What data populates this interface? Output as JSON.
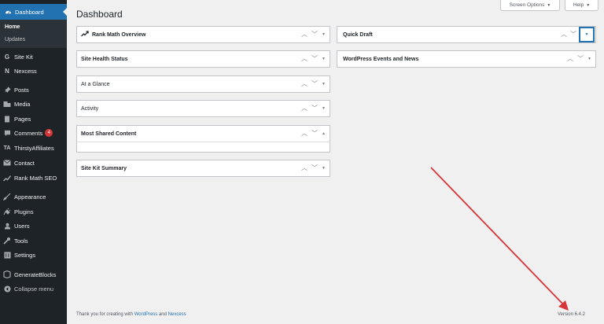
{
  "sidebar": {
    "dashboard": "Dashboard",
    "submenu": [
      "Home",
      "Updates"
    ],
    "items": [
      {
        "label": "Site Kit",
        "icon": "google-icon"
      },
      {
        "label": "Nexcess",
        "icon": "nexcess-icon"
      },
      {
        "label": "Posts",
        "icon": "pin-icon"
      },
      {
        "label": "Media",
        "icon": "media-icon"
      },
      {
        "label": "Pages",
        "icon": "pages-icon"
      },
      {
        "label": "Comments",
        "icon": "comment-icon",
        "badge": "4"
      },
      {
        "label": "ThirstyAffiliates",
        "icon": "ta-icon"
      },
      {
        "label": "Contact",
        "icon": "mail-icon"
      },
      {
        "label": "Rank Math SEO",
        "icon": "chart-icon"
      },
      {
        "label": "Appearance",
        "icon": "brush-icon"
      },
      {
        "label": "Plugins",
        "icon": "plugin-icon"
      },
      {
        "label": "Users",
        "icon": "user-icon"
      },
      {
        "label": "Tools",
        "icon": "wrench-icon"
      },
      {
        "label": "Settings",
        "icon": "settings-icon"
      },
      {
        "label": "GenerateBlocks",
        "icon": "blocks-icon"
      },
      {
        "label": "Collapse menu",
        "icon": "collapse-icon"
      }
    ]
  },
  "header": {
    "screen_options": "Screen Options",
    "help": "Help",
    "title": "Dashboard"
  },
  "panels": {
    "left": [
      "Rank Math Overview",
      "Site Health Status",
      "At a Glance",
      "Activity",
      "Most Shared Content",
      "Site Kit Summary"
    ],
    "right": [
      "Quick Draft",
      "WordPress Events and News"
    ]
  },
  "footer": {
    "prefix": "Thank you for creating with",
    "link1": "WordPress",
    "and": "and",
    "link2": "Nexcess",
    "version": "Version 6.4.2"
  },
  "colors": {
    "sidebar_bg": "#1d2327",
    "accent": "#2271b1",
    "arrow": "#d63638"
  }
}
